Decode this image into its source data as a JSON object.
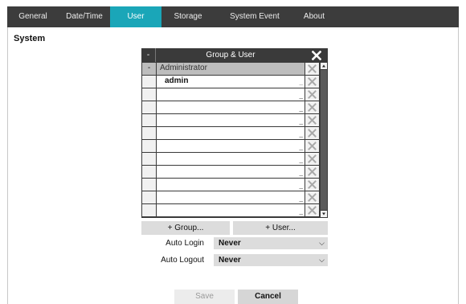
{
  "tabs": [
    {
      "label": "General"
    },
    {
      "label": "Date/Time"
    },
    {
      "label": "User",
      "active": true
    },
    {
      "label": "Storage"
    },
    {
      "label": "System Event"
    },
    {
      "label": "About"
    }
  ],
  "section_title": "System",
  "table": {
    "header_collapse": "-",
    "header_title": "Group & User",
    "rows": [
      {
        "type": "group",
        "toggle": "-",
        "name": "Administrator"
      },
      {
        "type": "user",
        "toggle": "",
        "name": "admin"
      },
      {
        "type": "empty",
        "toggle": "",
        "name": ""
      },
      {
        "type": "empty",
        "toggle": "",
        "name": ""
      },
      {
        "type": "empty",
        "toggle": "",
        "name": ""
      },
      {
        "type": "empty",
        "toggle": "",
        "name": ""
      },
      {
        "type": "empty",
        "toggle": "",
        "name": ""
      },
      {
        "type": "empty",
        "toggle": "",
        "name": ""
      },
      {
        "type": "empty",
        "toggle": "",
        "name": ""
      },
      {
        "type": "empty",
        "toggle": "",
        "name": ""
      },
      {
        "type": "empty",
        "toggle": "",
        "name": ""
      },
      {
        "type": "empty",
        "toggle": "",
        "name": ""
      }
    ]
  },
  "buttons": {
    "add_group": "+ Group...",
    "add_user": "+ User...",
    "save": "Save",
    "cancel": "Cancel"
  },
  "auto_login": {
    "label": "Auto Login",
    "value": "Never"
  },
  "auto_logout": {
    "label": "Auto Logout",
    "value": "Never"
  },
  "icons": {
    "delete": "close-icon",
    "scroll_up": "up-arrow-icon",
    "scroll_down": "down-arrow-icon",
    "dropdown": "chevron-down-icon"
  },
  "colors": {
    "tab_bar": "#3c3c3c",
    "active_tab": "#1aa6b8",
    "group_row": "#bdbdbd",
    "button": "#dcdcdc"
  }
}
